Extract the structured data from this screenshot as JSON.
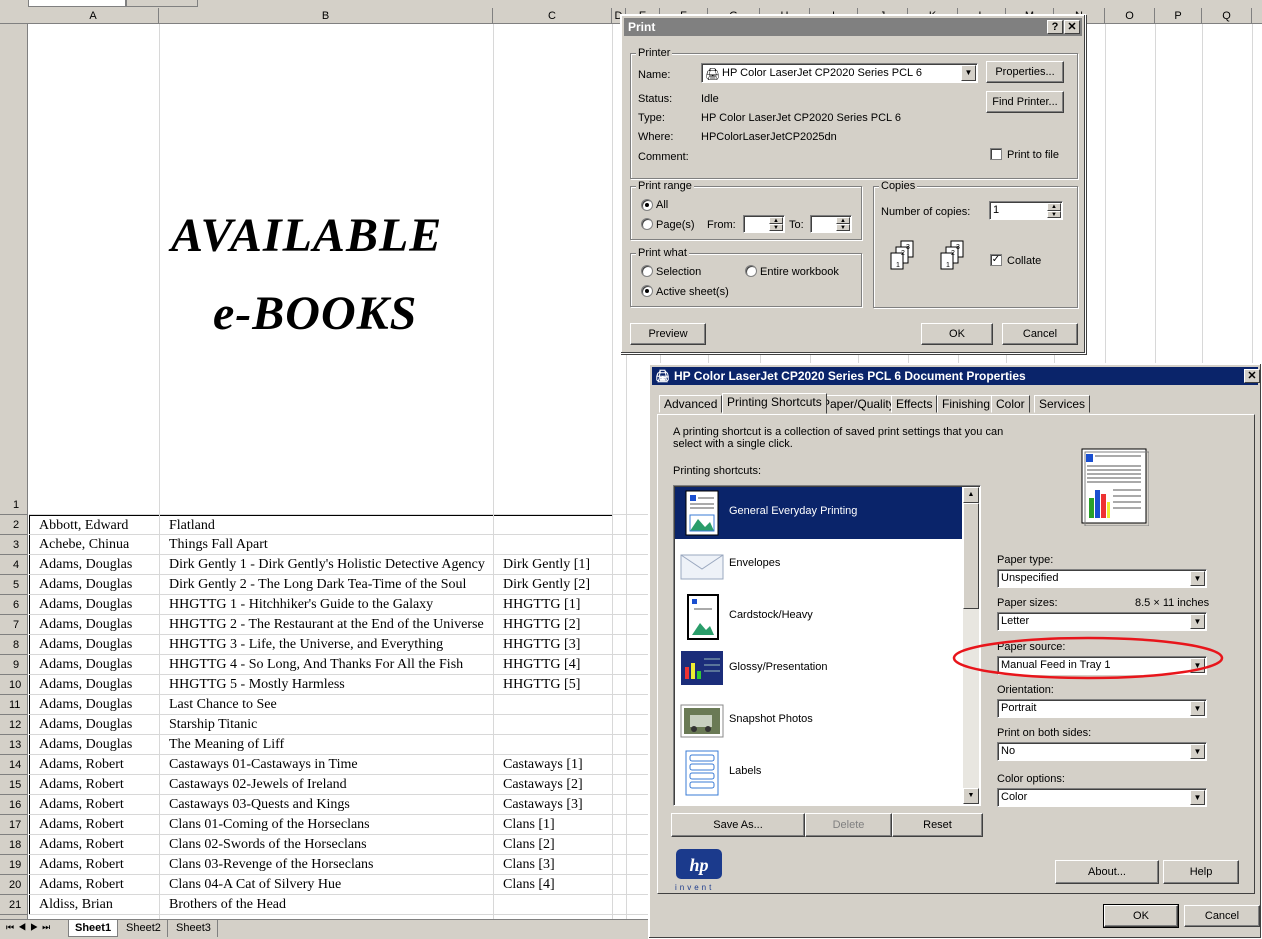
{
  "spreadsheet": {
    "columns": [
      "A",
      "B",
      "C",
      "D",
      "E",
      "F",
      "G",
      "H",
      "I",
      "J",
      "K",
      "L",
      "M",
      "N",
      "O",
      "P",
      "Q"
    ],
    "banner_line1": "AVAILABLE",
    "banner_line2": "e-BOOKS",
    "rows": [
      {
        "num": "2",
        "a": "Abbott, Edward",
        "b": "Flatland",
        "c": ""
      },
      {
        "num": "3",
        "a": "Achebe, Chinua",
        "b": "Things Fall Apart",
        "c": ""
      },
      {
        "num": "4",
        "a": "Adams, Douglas",
        "b": "Dirk Gently 1 - Dirk Gently's Holistic Detective Agency",
        "c": "Dirk Gently [1]"
      },
      {
        "num": "5",
        "a": "Adams, Douglas",
        "b": "Dirk Gently 2 - The Long Dark Tea-Time of the Soul",
        "c": "Dirk Gently [2]"
      },
      {
        "num": "6",
        "a": "Adams, Douglas",
        "b": "HHGTTG 1 - Hitchhiker's Guide to the Galaxy",
        "c": "HHGTTG [1]"
      },
      {
        "num": "7",
        "a": "Adams, Douglas",
        "b": "HHGTTG 2 - The Restaurant at the End of the Universe",
        "c": "HHGTTG [2]"
      },
      {
        "num": "8",
        "a": "Adams, Douglas",
        "b": "HHGTTG 3 - Life, the Universe, and Everything",
        "c": "HHGTTG [3]"
      },
      {
        "num": "9",
        "a": "Adams, Douglas",
        "b": "HHGTTG 4 - So Long, And Thanks For All the Fish",
        "c": "HHGTTG [4]"
      },
      {
        "num": "10",
        "a": "Adams, Douglas",
        "b": "HHGTTG 5 - Mostly Harmless",
        "c": "HHGTTG [5]"
      },
      {
        "num": "11",
        "a": "Adams, Douglas",
        "b": "Last Chance to See",
        "c": ""
      },
      {
        "num": "12",
        "a": "Adams, Douglas",
        "b": "Starship Titanic",
        "c": ""
      },
      {
        "num": "13",
        "a": "Adams, Douglas",
        "b": "The Meaning of Liff",
        "c": ""
      },
      {
        "num": "14",
        "a": "Adams, Robert",
        "b": "Castaways 01-Castaways in Time",
        "c": "Castaways [1]"
      },
      {
        "num": "15",
        "a": "Adams, Robert",
        "b": "Castaways 02-Jewels of Ireland",
        "c": "Castaways [2]"
      },
      {
        "num": "16",
        "a": "Adams, Robert",
        "b": "Castaways 03-Quests and Kings",
        "c": "Castaways [3]"
      },
      {
        "num": "17",
        "a": "Adams, Robert",
        "b": "Clans 01-Coming of the Horseclans",
        "c": "Clans [1]"
      },
      {
        "num": "18",
        "a": "Adams, Robert",
        "b": "Clans 02-Swords of the Horseclans",
        "c": "Clans [2]"
      },
      {
        "num": "19",
        "a": "Adams, Robert",
        "b": "Clans 03-Revenge of the Horseclans",
        "c": "Clans [3]"
      },
      {
        "num": "20",
        "a": "Adams, Robert",
        "b": "Clans 04-A Cat of Silvery Hue",
        "c": "Clans [4]"
      },
      {
        "num": "21",
        "a": "Aldiss, Brian",
        "b": "Brothers of the Head",
        "c": ""
      }
    ],
    "first_row_num": "1",
    "sheet_tabs": [
      "Sheet1",
      "Sheet2",
      "Sheet3"
    ]
  },
  "print_dialog": {
    "title": "Print",
    "printer_group": "Printer",
    "name_label": "Name:",
    "name_value": "HP Color LaserJet CP2020 Series PCL 6",
    "properties_button": "Properties...",
    "find_printer_button": "Find Printer...",
    "status_label": "Status:",
    "status_value": "Idle",
    "type_label": "Type:",
    "type_value": "HP Color LaserJet CP2020 Series PCL 6",
    "where_label": "Where:",
    "where_value": "HPColorLaserJetCP2025dn",
    "comment_label": "Comment:",
    "print_to_file": "Print to file",
    "print_range_group": "Print range",
    "all_label": "All",
    "pages_label": "Page(s)",
    "from_label": "From:",
    "to_label": "To:",
    "copies_group": "Copies",
    "num_copies_label": "Number of copies:",
    "num_copies_value": "1",
    "collate_label": "Collate",
    "print_what_group": "Print what",
    "selection_label": "Selection",
    "entire_workbook_label": "Entire workbook",
    "active_sheets_label": "Active sheet(s)",
    "preview_button": "Preview",
    "ok_button": "OK",
    "cancel_button": "Cancel"
  },
  "props_dialog": {
    "title": "HP Color LaserJet CP2020 Series PCL 6 Document Properties",
    "tabs": [
      "Advanced",
      "Printing Shortcuts",
      "Paper/Quality",
      "Effects",
      "Finishing",
      "Color",
      "Services"
    ],
    "description": "A printing shortcut is a collection of saved print settings that you can select with a single click.",
    "shortcuts_label": "Printing shortcuts:",
    "shortcuts": [
      "General Everyday Printing",
      "Envelopes",
      "Cardstock/Heavy",
      "Glossy/Presentation",
      "Snapshot Photos",
      "Labels"
    ],
    "save_as_button": "Save As...",
    "delete_button": "Delete",
    "reset_button": "Reset",
    "paper_type_label": "Paper type:",
    "paper_type_value": "Unspecified",
    "paper_sizes_label": "Paper sizes:",
    "paper_sizes_dim": "8.5 × 11 inches",
    "paper_sizes_value": "Letter",
    "paper_source_label": "Paper source:",
    "paper_source_value": "Manual Feed in Tray 1",
    "orientation_label": "Orientation:",
    "orientation_value": "Portrait",
    "both_sides_label": "Print on both sides:",
    "both_sides_value": "No",
    "color_options_label": "Color options:",
    "color_options_value": "Color",
    "hp_logo_text": "invent",
    "about_button": "About...",
    "help_button": "Help",
    "ok_button": "OK",
    "cancel_button": "Cancel"
  },
  "colors": {
    "title_active": "#0a246a",
    "title_inactive": "#808080",
    "highlight": "#0a246a",
    "annotation": "#e8151b"
  }
}
